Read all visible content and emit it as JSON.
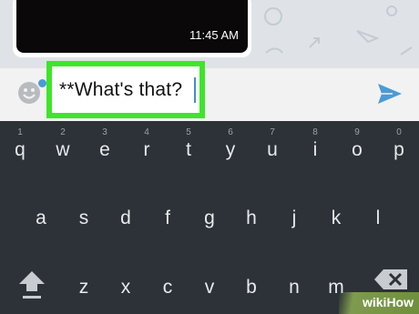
{
  "chat": {
    "timestamp": "11:45 AM"
  },
  "composer": {
    "text": "**What's that?"
  },
  "icons": {
    "emoji": "smiley-face-icon",
    "send": "paper-plane-send-icon",
    "shift": "shift-arrow-icon",
    "backspace": "backspace-icon"
  },
  "keyboard": {
    "row1": [
      {
        "k": "q",
        "h": "1"
      },
      {
        "k": "w",
        "h": "2"
      },
      {
        "k": "e",
        "h": "3"
      },
      {
        "k": "r",
        "h": "4"
      },
      {
        "k": "t",
        "h": "5"
      },
      {
        "k": "y",
        "h": "6"
      },
      {
        "k": "u",
        "h": "7"
      },
      {
        "k": "i",
        "h": "8"
      },
      {
        "k": "o",
        "h": "9"
      },
      {
        "k": "p",
        "h": "0"
      }
    ],
    "row2": [
      "a",
      "s",
      "d",
      "f",
      "g",
      "h",
      "j",
      "k",
      "l"
    ],
    "row3": [
      "z",
      "x",
      "c",
      "v",
      "b",
      "n",
      "m"
    ]
  },
  "watermark": {
    "text": "wikiHow"
  },
  "colors": {
    "highlight": "#3ee52a",
    "accent": "#4a9bd6",
    "keyboard_bg": "#2c3238"
  }
}
